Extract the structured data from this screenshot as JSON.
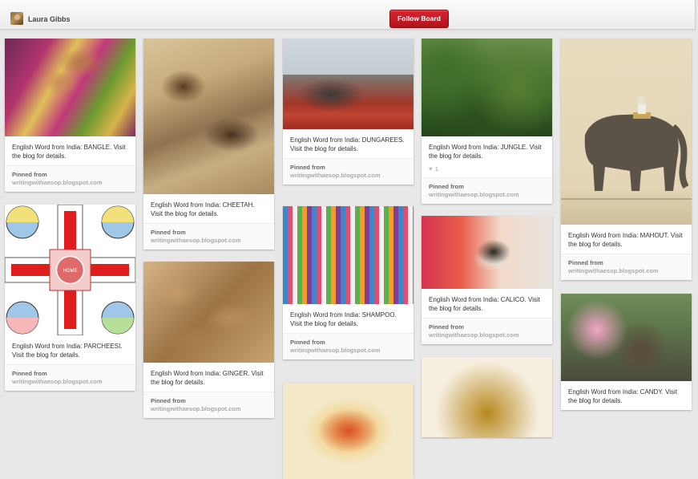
{
  "header": {
    "user_name": "Laura Gibbs",
    "follow_label": "Follow Board"
  },
  "pin_labels": {
    "pinned_from": "Pinned from",
    "source": "writingwithaesop.blogspot.com"
  },
  "colors": {
    "accent": "#c8151f",
    "background": "#e9e8e8"
  },
  "pins": [
    {
      "image": "bangle-photo",
      "description": "English Word from India: BANGLE. Visit the blog for details."
    },
    {
      "image": "cheetah-painting",
      "description": "English Word from India: CHEETAH. Visit the blog for details."
    },
    {
      "image": "dungarees-photo",
      "description": "English Word from India: DUNGAREES. Visit the blog for details."
    },
    {
      "image": "jungle-photo",
      "description": "English Word from India: JUNGLE. Visit the blog for details.",
      "likes": "1"
    },
    {
      "image": "mahout-painting",
      "description": "English Word from India: MAHOUT. Visit the blog for details."
    },
    {
      "image": "parcheesi-board",
      "description": "English Word from India: PARCHEESI. Visit the blog for details.",
      "board_text": "HOME"
    },
    {
      "image": "ginger-photo",
      "description": "English Word from India: GINGER. Visit the blog for details."
    },
    {
      "image": "shampoo-photo",
      "description": "English Word from India: SHAMPOO. Visit the blog for details."
    },
    {
      "image": "calico-cat-photo",
      "description": "English Word from India: CALICO. Visit the blog for details."
    },
    {
      "image": "candy-photo",
      "description": "English Word from India: CANDY. Visit the blog for details."
    },
    {
      "image": "rangoli-image"
    },
    {
      "image": "mandala-painting"
    }
  ]
}
